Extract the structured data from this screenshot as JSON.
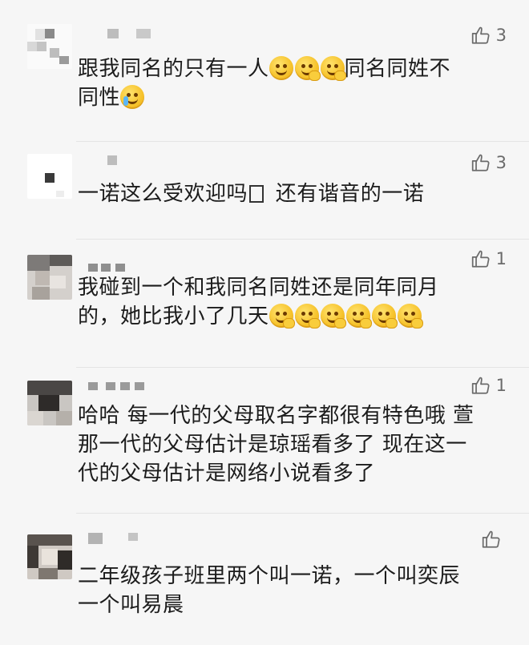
{
  "comments": [
    {
      "likes": "3",
      "text_parts": [
        "跟我同名的只有一人",
        "同名同姓不",
        "同性"
      ],
      "emoji_inline_1": [
        "doge-smirk-emoji",
        "smirk-hand-emoji",
        "smirk-hand-emoji"
      ],
      "emoji_inline_2": [
        "crying-laugh-emoji"
      ]
    },
    {
      "likes": "3",
      "text_parts": [
        "一诺这么受欢迎吗",
        "还有谐音的一诺"
      ],
      "box_glyph": "□"
    },
    {
      "likes": "1",
      "text_parts": [
        "我碰到一个和我同名同姓还是同年同月",
        "的，她比我小了几天"
      ],
      "emoji_inline": [
        "grin-hand-emoji",
        "grin-hand-emoji",
        "grin-hand-emoji",
        "grin-hand-emoji",
        "grin-hand-emoji",
        "grin-hand-emoji"
      ]
    },
    {
      "likes": "1",
      "text_parts": [
        "哈哈 每一代的父母取名字都很有特色哦 萱",
        "那一代的父母估计是琼瑶看多了 现在这一",
        "代的父母估计是网络小说看多了"
      ]
    },
    {
      "likes": "",
      "text_parts": [
        "二年级孩子班里两个叫一诺，一个叫奕辰",
        "一个叫易晨"
      ]
    }
  ],
  "colors": {
    "background": "#f6f6f6",
    "text": "#1c1c1c",
    "like_icon": "#6b6b6b",
    "divider": "#e4e4e4"
  },
  "icons": {
    "like": "thumbs-up-icon"
  }
}
